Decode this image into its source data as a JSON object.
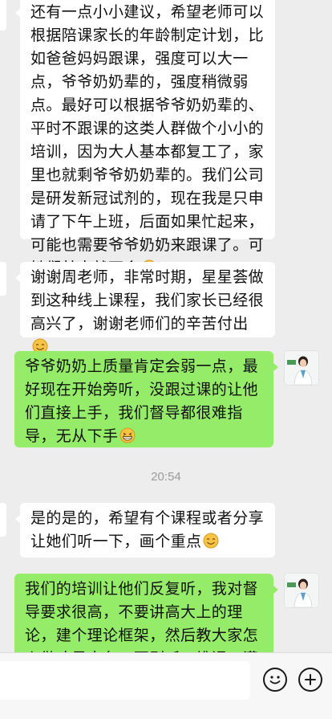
{
  "messages": [
    {
      "side": "in",
      "text": "还有一点小小建议，希望老师可以根据陪课家长的年龄制定计划，比如爸爸妈妈跟课，强度可以大一点，爷爷奶奶辈的，强度稍微弱点。最好可以根据爷爷奶奶辈的、平时不跟课的这类人群做个小小的培训，因为大人基本都复工了，家里也就剩爷爷奶奶辈的。我们公司是研发新冠试剂的，现在我是只申请了下午上班，后面如果忙起来，可能也需要爷爷奶奶来跟课了。可她们基本就不会",
      "emoji": "flushed-emoji"
    },
    {
      "side": "in",
      "text": "谢谢周老师，非常时期，星星荟做到这种线上课程，我们家长已经很高兴了，谢谢老师们的辛苦付出",
      "emoji": "smile-emoji"
    },
    {
      "side": "out",
      "text": "爷爷奶奶上质量肯定会弱一点，最好现在开始旁听，没跟过课的让他们直接上手，我们督导都很难指导，无从下手",
      "emoji": "grin-emoji"
    },
    {
      "side": "in",
      "text": "是的是的，希望有个课程或者分享让她们听一下，画个重点",
      "emoji": "smile-emoji"
    },
    {
      "side": "out",
      "text": "我们的培训让他们反复听，我对督导要求很高，不要讲高大上的理论，建个理论框架，然后教大家怎么做才是实务，否则听一堆课，满",
      "emoji": ""
    }
  ],
  "timestamp": "20:54",
  "input_bar": {
    "emoji_button": "emoji-face-icon",
    "plus_button": "plus-icon"
  },
  "colors": {
    "background": "#ededed",
    "incoming_bubble": "#ffffff",
    "outgoing_bubble": "#95ec69"
  }
}
